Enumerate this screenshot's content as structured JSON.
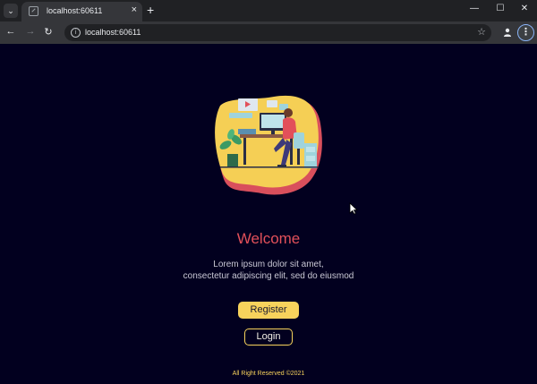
{
  "browser": {
    "tab_title": "localhost:60611",
    "url": "localhost:60611",
    "icons": {
      "tab_search": "chevron-down-icon",
      "tab_close": "close-icon",
      "new_tab": "plus-icon",
      "minimize": "minimize-icon",
      "maximize": "maximize-icon",
      "close_window": "close-icon",
      "back": "back-arrow-icon",
      "forward": "forward-arrow-icon",
      "reload": "reload-icon",
      "site_info": "info-icon",
      "bookmark": "star-icon",
      "profile": "person-icon",
      "menu": "kebab-menu-icon"
    }
  },
  "page": {
    "title": "Welcome",
    "subtitle_line1": "Lorem ipsum dolor sit amet,",
    "subtitle_line2": "consectetur adipiscing elit, sed do eiusmod",
    "register_label": "Register",
    "login_label": "Login",
    "footer": "All Right Reserved ©2021",
    "colors": {
      "background": "#02001f",
      "title": "#e2505a",
      "accent": "#f7d25c",
      "illustration_blob": "#f5cf55",
      "illustration_shadow": "#d94f5c"
    }
  }
}
